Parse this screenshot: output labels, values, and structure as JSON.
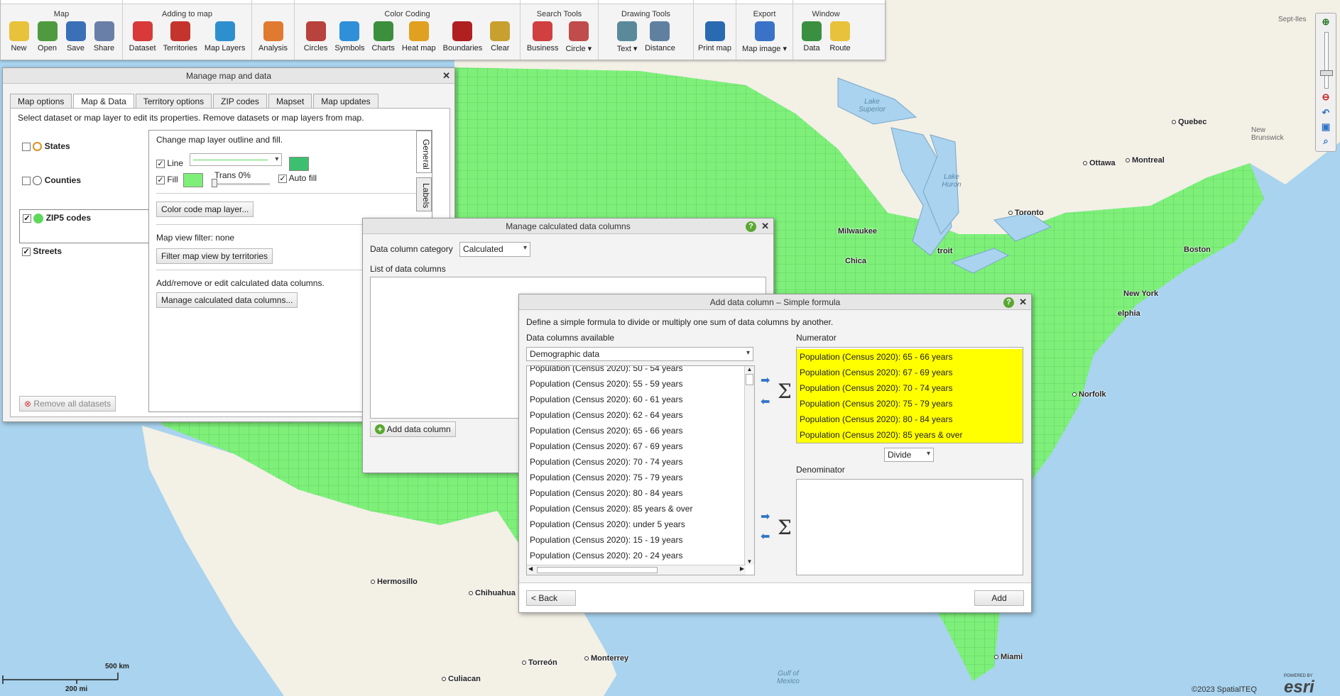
{
  "toolbar": {
    "groups": [
      {
        "title": "Map",
        "buttons": [
          {
            "label": "New",
            "icon": "new-document-icon"
          },
          {
            "label": "Open",
            "icon": "open-folder-icon"
          },
          {
            "label": "Save",
            "icon": "save-disk-icon"
          },
          {
            "label": "Share",
            "icon": "share-people-icon"
          }
        ]
      },
      {
        "title": "Adding to map",
        "buttons": [
          {
            "label": "Dataset",
            "icon": "dataset-pin-icon"
          },
          {
            "label": "Territories",
            "icon": "territories-icon"
          },
          {
            "label": "Map Layers",
            "icon": "globe-icon"
          }
        ]
      },
      {
        "title": "",
        "buttons": [
          {
            "label": "Analysis",
            "icon": "analysis-icon"
          }
        ]
      },
      {
        "title": "Color Coding",
        "buttons": [
          {
            "label": "Circles",
            "icon": "circles-icon"
          },
          {
            "label": "Symbols",
            "icon": "symbols-icon"
          },
          {
            "label": "Charts",
            "icon": "charts-icon"
          },
          {
            "label": "Heat map",
            "icon": "heat-map-icon"
          },
          {
            "label": "Boundaries",
            "icon": "boundaries-icon"
          },
          {
            "label": "Clear",
            "icon": "clear-icon"
          }
        ]
      },
      {
        "title": "Search Tools",
        "buttons": [
          {
            "label": "Business",
            "icon": "business-icon"
          },
          {
            "label": "Circle ▾",
            "icon": "circle-search-icon"
          }
        ]
      },
      {
        "title": "Drawing Tools",
        "buttons": [
          {
            "label": "Text ▾",
            "icon": "text-tool-icon"
          },
          {
            "label": "Distance",
            "icon": "ruler-icon"
          }
        ]
      },
      {
        "title": "",
        "buttons": [
          {
            "label": "Print map",
            "icon": "printer-icon"
          }
        ]
      },
      {
        "title": "Export",
        "buttons": [
          {
            "label": "Map image ▾",
            "icon": "map-image-icon"
          }
        ]
      },
      {
        "title": "Window",
        "buttons": [
          {
            "label": "Data",
            "icon": "data-grid-icon"
          },
          {
            "label": "Route",
            "icon": "route-car-icon"
          }
        ]
      }
    ]
  },
  "manage_map": {
    "title": "Manage map and data",
    "tabs": [
      "Map options",
      "Map & Data",
      "Territory options",
      "ZIP codes",
      "Mapset",
      "Map updates"
    ],
    "active_tab": "Map & Data",
    "instruction": "Select dataset or map layer to edit its properties. Remove datasets or map layers from map.",
    "layers": [
      {
        "name": "States",
        "checked": false
      },
      {
        "name": "Counties",
        "checked": false
      },
      {
        "name": "ZIP5 codes",
        "checked": true
      },
      {
        "name": "Streets",
        "checked": true
      }
    ],
    "remove_all": "Remove all datasets",
    "outline_heading": "Change map layer outline and fill.",
    "line_label": "Line",
    "fill_label": "Fill",
    "trans_label": "Trans 0%",
    "auto_fill_label": "Auto fill",
    "color_code_button": "Color code map layer...",
    "filter_text": "Map view filter: none",
    "filter_button": "Filter map view by territories",
    "calc_text": "Add/remove or edit calculated data columns.",
    "calc_button": "Manage calculated data columns...",
    "side_tabs": [
      "General",
      "Labels"
    ]
  },
  "calc_columns": {
    "title": "Manage calculated data columns",
    "category_label": "Data column category",
    "category_value": "Calculated",
    "list_label": "List of data columns",
    "add_button": "Add data column"
  },
  "formula": {
    "title": "Add data column – Simple formula",
    "description": "Define a simple formula to divide or multiply one sum of data columns by another.",
    "available_label": "Data columns available",
    "available_select": "Demographic data",
    "available": [
      "Population (Census 2020): 50 - 54 years",
      "Population (Census 2020): 55 - 59 years",
      "Population (Census 2020): 60 - 61 years",
      "Population (Census 2020): 62 - 64 years",
      "Population (Census 2020): 65 - 66 years",
      "Population (Census 2020): 67 - 69 years",
      "Population (Census 2020): 70 - 74 years",
      "Population (Census 2020): 75 - 79 years",
      "Population (Census 2020): 80 - 84 years",
      "Population (Census 2020): 85 years & over",
      "Population (Census 2020): under 5 years",
      "Population (Census 2020): 15 - 19 years",
      "Population (Census 2020): 20 - 24 years"
    ],
    "numerator_label": "Numerator",
    "numerator": [
      "Population (Census 2020): 65 - 66 years",
      "Population (Census 2020): 67 - 69 years",
      "Population (Census 2020): 70 - 74 years",
      "Population (Census 2020): 75 - 79 years",
      "Population (Census 2020): 80 - 84 years",
      "Population (Census 2020): 85 years & over"
    ],
    "operation": "Divide",
    "denominator_label": "Denominator",
    "sigma": "Σ",
    "back_button": "< Back",
    "add_button": "Add"
  },
  "map": {
    "cities": [
      "Quebec",
      "Ottawa",
      "Montreal",
      "Toronto",
      "Milwaukee",
      "Chica",
      "troit",
      "Boston",
      "New York",
      "elphia",
      "Norfolk",
      "Miami",
      "Hermosillo",
      "Chihuahua",
      "Monterrey",
      "Torreón",
      "Culiacan"
    ],
    "water": [
      "Lake Superior",
      "Lake Huron",
      "Gulf of Mexico"
    ],
    "regions": [
      "Sept-Iles",
      "New Brunswick"
    ],
    "scale_top": "500 km",
    "scale_bottom": "200 mi",
    "credit": "©2023 SpatialTEQ",
    "esri_powered": "POWERED BY",
    "esri": "esri"
  },
  "colors": {
    "zip_fill": "#7ef07a",
    "land": "#f3f0e6",
    "water": "#a9d3ee",
    "numerator_highlight": "#ffff00"
  }
}
